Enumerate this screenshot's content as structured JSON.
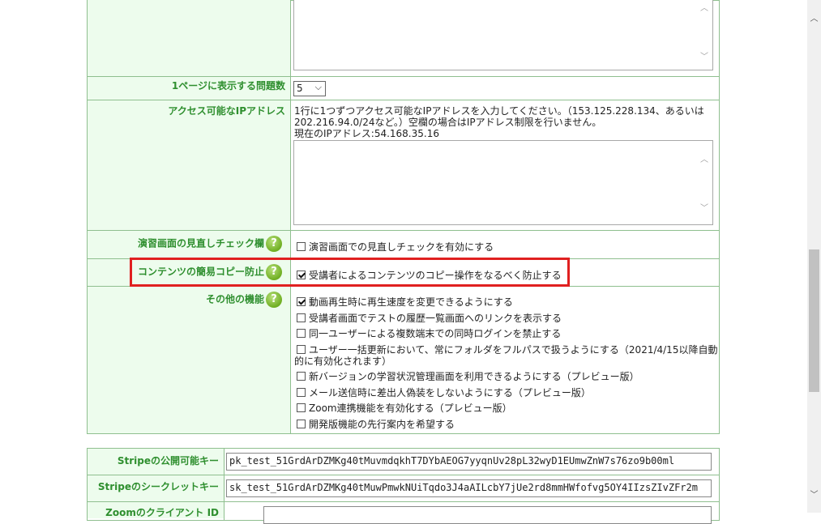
{
  "rows": {
    "questions_per_page": {
      "label": "1ページに表示する問題数",
      "value": "5"
    },
    "ip_access": {
      "label": "アクセス可能なIPアドレス",
      "description_line1": "1行に1つずつアクセス可能なIPアドレスを入力してください。（153.125.228.134、あるいは",
      "description_line2": "202.216.94.0/24など。）空欄の場合はIPアドレス制限を行いません。",
      "current_ip": "現在のIPアドレス:54.168.35.16"
    },
    "review_check": {
      "label": "演習画面の見直しチェック欄",
      "option": "演習画面での見直しチェックを有効にする"
    },
    "copy_protect": {
      "label": "コンテンツの簡易コピー防止",
      "option": "受講者によるコンテンツのコピー操作をなるべく防止する"
    },
    "other_features": {
      "label": "その他の機能",
      "options": [
        {
          "text": "動画再生時に再生速度を変更できるようにする",
          "checked": true
        },
        {
          "text": "受講者画面でテストの履歴一覧画面へのリンクを表示する",
          "checked": false
        },
        {
          "text": "同一ユーザーによる複数端末での同時ログインを禁止する",
          "checked": false
        },
        {
          "text": "ユーザー一括更新において、常にフォルダをフルパスで扱うようにする（2021/4/15以降自動",
          "text2": "的に有効化されます）",
          "checked": false
        },
        {
          "text": "新バージョンの学習状況管理画面を利用できるようにする（プレビュー版）",
          "checked": false
        },
        {
          "text": "メール送信時に差出人偽装をしないようにする（プレビュー版）",
          "checked": false
        },
        {
          "text": "Zoom連携機能を有効化する（プレビュー版）",
          "checked": false
        },
        {
          "text": "開発版機能の先行案内を希望する",
          "checked": false
        }
      ]
    }
  },
  "keys": {
    "stripe_public": {
      "label": "Stripeの公開可能キー",
      "value": "pk_test_51GrdArDZMKg40tMuvmdqkhT7DYbAEOG7yyqnUv28pL32wyD1EUmwZnW7s76zo9b00ml"
    },
    "stripe_secret": {
      "label": "Stripeのシークレットキー",
      "value": "sk_test_51GrdArDZMKg40tMuwPmwkNUiTqdo3J4aAILcbY7jUe2rd8mmHWfofvg5OY4IIzsZIvZFr2m"
    },
    "zoom_client": {
      "label": "Zoomのクライアント ID",
      "value": ""
    }
  },
  "help_icon_glyph": "?",
  "colors": {
    "label_text": "#2f8f2f",
    "label_bg": "#edfced",
    "border": "#8fbf8f",
    "highlight": "#e02020",
    "help_icon": "#7ab82e"
  }
}
